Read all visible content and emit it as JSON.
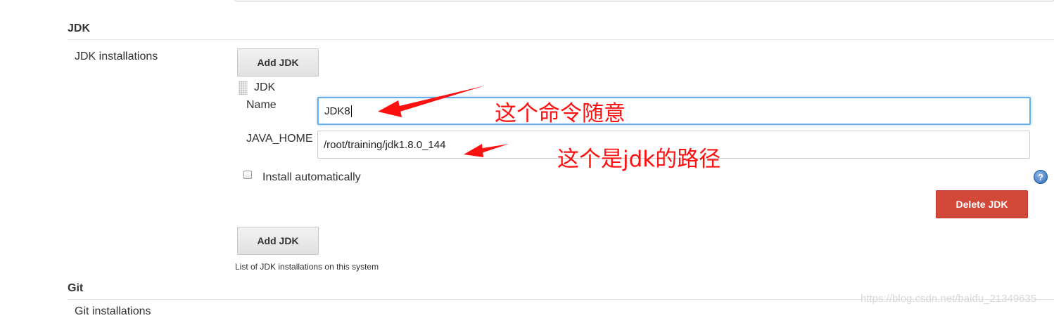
{
  "jdk_section": {
    "title": "JDK",
    "installations_label": "JDK installations",
    "add_button_label": "Add JDK",
    "entry": {
      "header": "JDK",
      "name_label": "Name",
      "name_value": "JDK8",
      "java_home_label": "JAVA_HOME",
      "java_home_value": "/root/training/jdk1.8.0_144",
      "install_auto_label": "Install automatically",
      "install_auto_checked": false,
      "help_icon_glyph": "?",
      "delete_button_label": "Delete JDK"
    },
    "add_button_bottom_label": "Add JDK",
    "description": "List of JDK installations on this system"
  },
  "git_section": {
    "title": "Git",
    "installations_label": "Git installations"
  },
  "annotations": {
    "name_note": "这个命令随意",
    "java_home_note": "这个是jdk的路径",
    "color": "#ff1010"
  },
  "watermark": "https://blog.csdn.net/baidu_21349635",
  "colors": {
    "delete_button": "#d24939",
    "focus_border": "#66afe9",
    "help_icon": "#2a6cb8"
  },
  "icons": {
    "drag_handle": "grip-icon",
    "help": "help-icon"
  }
}
